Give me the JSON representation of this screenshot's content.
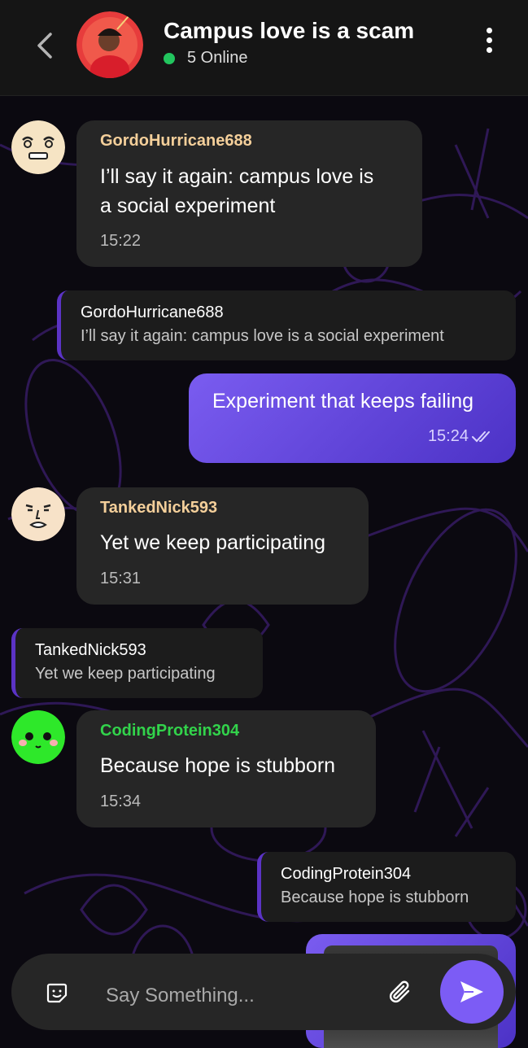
{
  "header": {
    "title": "Campus love is a scam",
    "online": "5 Online"
  },
  "messages": [
    {
      "sender": "GordoHurricane688",
      "text_line1": "I’ll say it again: campus love is",
      "text_line2": "a social experiment",
      "time": "15:22",
      "sender_color": "#f4cf9a"
    },
    {
      "quote_name": "GordoHurricane688",
      "quote_text": "I’ll say it again: campus love is a social experiment"
    },
    {
      "text": "Experiment that keeps failing",
      "time": "15:24",
      "outgoing": true
    },
    {
      "sender": "TankedNick593",
      "text": "Yet we keep participating",
      "time": "15:31",
      "sender_color": "#f4cf9a"
    },
    {
      "quote_name": "TankedNick593",
      "quote_text": "Yet we keep participating"
    },
    {
      "sender": "CodingProtein304",
      "text": "Because hope is stubborn",
      "time": "15:34",
      "sender_color": "#32d34b"
    },
    {
      "quote_name": "CodingProtein304",
      "quote_text": "Because hope is stubborn"
    }
  ],
  "composer": {
    "placeholder": "Say Something..."
  },
  "icons": [
    "back-chevron-icon",
    "more-vertical-icon",
    "sticker-icon",
    "paperclip-icon",
    "send-icon",
    "double-check-icon"
  ],
  "colors": {
    "accent": "#7c5cf5",
    "online": "#22c55e",
    "bubble_in": "#262626",
    "background": "#0b0910"
  }
}
